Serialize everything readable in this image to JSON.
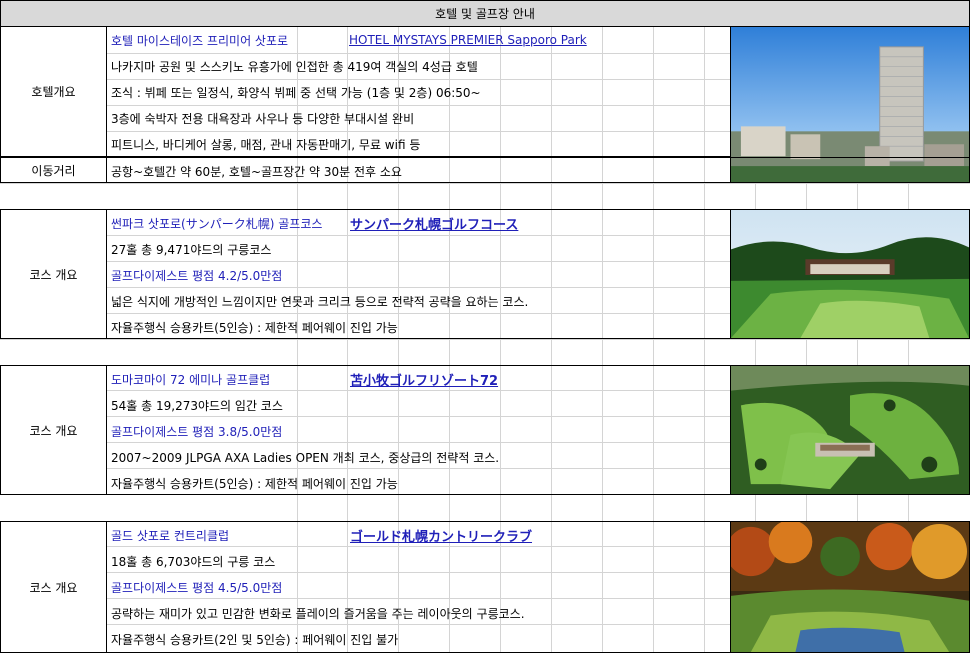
{
  "header": {
    "title": "호텔 및 골프장 안내"
  },
  "hotel": {
    "label_overview": "호텔개요",
    "label_distance": "이동거리",
    "name_ko": "호텔 마이스테이즈 프리미어 삿포로",
    "name_en": "HOTEL MYSTAYS PREMIER Sapporo Park",
    "lines": [
      "나카지마 공원 및 스스키노 유흥가에 인접한 총 419여 객실의 4성급 호텔",
      "조식 : 뷔페 또는 일정식, 화양식 뷔페 중 선택 가능 (1층 및 2층) 06:50~",
      "3층에 숙박자 전용 대욕장과 사우나 등 다양한 부대시설 완비",
      "피트니스, 바디케어 살롱, 매점, 관내 자동판매기, 무료 wifi 등"
    ],
    "distance": "공항~호텔간 약 60분, 호텔~골프장간 약 30분 전후 소요"
  },
  "courses": [
    {
      "label": "코스 개요",
      "name_ko": "썬파크 삿포로(サンパーク札幌) 골프코스",
      "name_jp": "サンパーク札幌ゴルフコース",
      "holes": "27홀 총 9,471야드의 구릉코스",
      "rating": "골프다이제스트 평점 4.2/5.0만점",
      "desc": "넓은 식지에 개방적인 느낌이지만 연못과 크리크 등으로 전략적 공략을 요하는 코스.",
      "cart": "자율주행식 승용카트(5인승) : 제한적 페어웨이 진입 가능"
    },
    {
      "label": "코스 개요",
      "name_ko": "도마코마이 72 에미나 골프클럽",
      "name_jp": "苫小牧ゴルフリゾート72",
      "holes": "54홀 총 19,273야드의 임간 코스",
      "rating": "골프다이제스트 평점 3.8/5.0만점",
      "desc": "2007~2009 JLPGA AXA Ladies OPEN 개최 코스, 중상급의 전략적 코스.",
      "cart": "자율주행식 승용카트(5인승) : 제한적 페어웨이 진입 가능"
    },
    {
      "label": "코스 개요",
      "name_ko": "골드 삿포로 컨트리클럽",
      "name_jp": "ゴールド札幌カントリークラブ",
      "holes": "18홀 총 6,703야드의 구릉 코스",
      "rating": "골프다이제스트 평점 4.5/5.0만점",
      "desc": "공략하는 재미가 있고 민감한 변화로 플레이의 즐거움을 주는 레이아웃의 구릉코스.",
      "cart": "자율주행식 승용카트(2인 및 5인승) :  페어웨이 진입 불가"
    }
  ],
  "colors": {
    "link": "#1f1fb8",
    "header_bg": "#d9d9d9"
  }
}
